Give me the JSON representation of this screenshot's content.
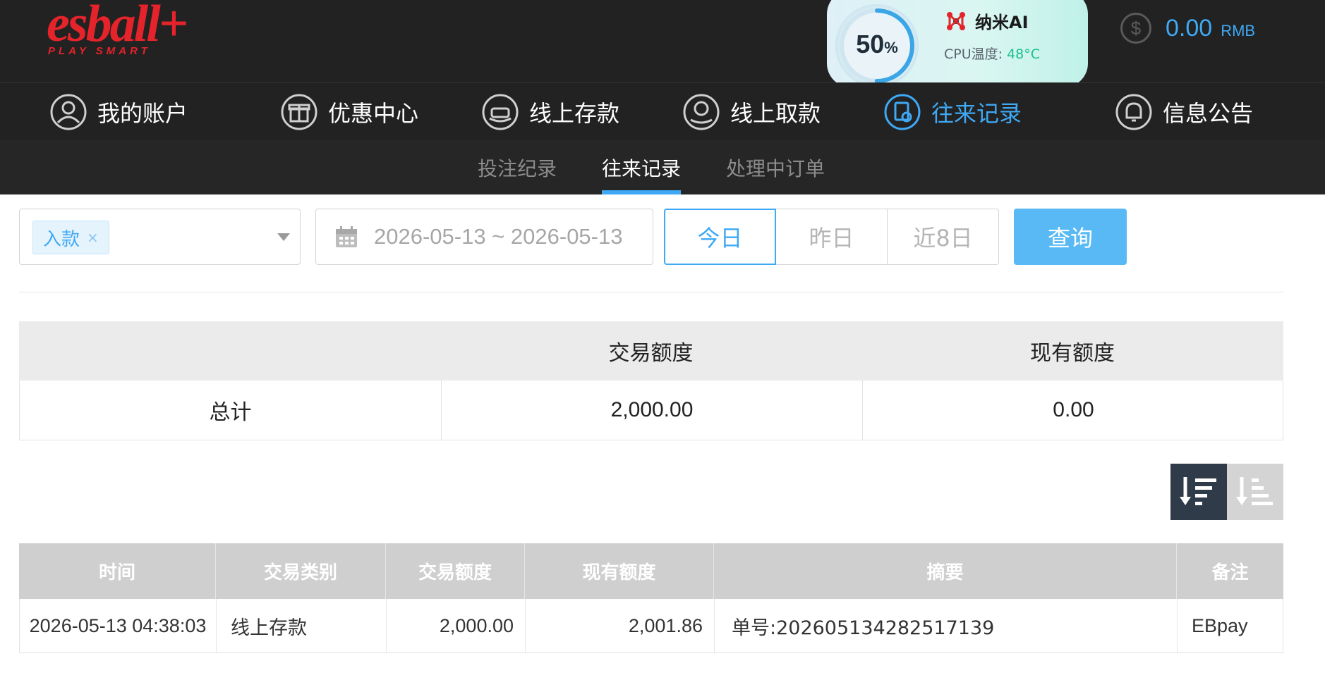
{
  "brand": {
    "logo_main": "esball+",
    "logo_sub": "PLAY SMART"
  },
  "widget": {
    "percent": "50",
    "percent_unit": "%",
    "percent_value": 0.5,
    "title": "纳米AI",
    "cpu_label": "CPU温度: ",
    "cpu_value": "48°C"
  },
  "balance": {
    "amount": "0.00",
    "unit": "RMB",
    "icon": "dollar-icon"
  },
  "main_nav": [
    {
      "label": "我的账户",
      "icon": "user-icon"
    },
    {
      "label": "优惠中心",
      "icon": "gift-icon"
    },
    {
      "label": "线上存款",
      "icon": "deposit-icon"
    },
    {
      "label": "线上取款",
      "icon": "withdraw-icon"
    },
    {
      "label": "往来记录",
      "icon": "records-icon",
      "active": true
    },
    {
      "label": "信息公告",
      "icon": "bell-icon"
    }
  ],
  "sub_nav": [
    {
      "label": "投注纪录"
    },
    {
      "label": "往来记录",
      "active": true
    },
    {
      "label": "处理中订单"
    }
  ],
  "filter": {
    "type_tag": "入款",
    "tag_close": "×",
    "date_range": "2026-05-13 ~ 2026-05-13",
    "quick_ranges": [
      "今日",
      "昨日",
      "近8日"
    ],
    "selected_range": "今日",
    "query_label": "查询"
  },
  "summary": {
    "headers": [
      "",
      "交易额度",
      "现有额度"
    ],
    "row": [
      "总计",
      "2,000.00",
      "0.00"
    ]
  },
  "records": {
    "headers": [
      "时间",
      "交易类别",
      "交易额度",
      "现有额度",
      "摘要",
      "备注"
    ],
    "rows": [
      [
        "2026-05-13 04:38:03",
        "线上存款",
        "2,000.00",
        "2,001.86",
        "单号:202605134282517139",
        "EBpay"
      ]
    ]
  },
  "colors": {
    "accent": "#3fa9f5",
    "brand_red": "#e4232a",
    "header_bg": "#222222"
  }
}
